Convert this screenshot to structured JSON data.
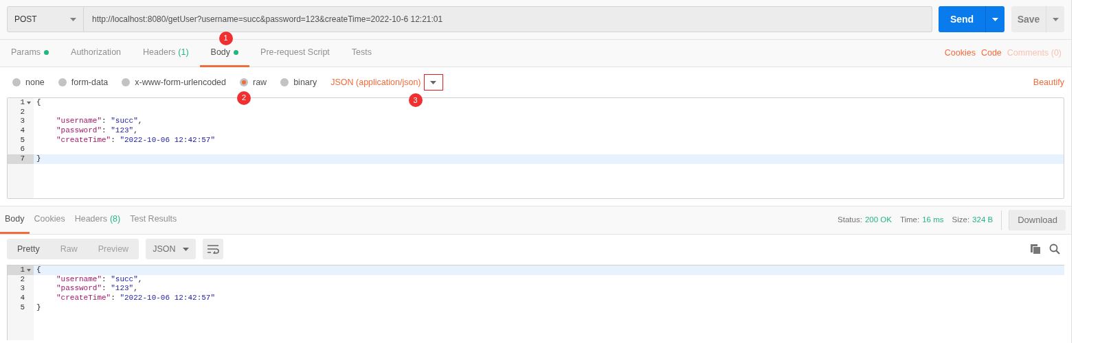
{
  "request": {
    "method": "POST",
    "url": "http://localhost:8080/getUser?username=succ&password=123&createTime=2022-10-6 12:21:01",
    "send": "Send",
    "save": "Save"
  },
  "request_tabs": [
    {
      "label": "Params",
      "dot": true,
      "selected": false
    },
    {
      "label": "Authorization",
      "selected": false
    },
    {
      "label": "Headers",
      "count": "(1)",
      "selected": false
    },
    {
      "label": "Body",
      "dot": true,
      "selected": true,
      "annotation": "1"
    },
    {
      "label": "Pre-request Script",
      "selected": false
    },
    {
      "label": "Tests",
      "selected": false
    }
  ],
  "request_links": [
    {
      "label": "Cookies",
      "disabled": false
    },
    {
      "label": "Code",
      "disabled": false
    },
    {
      "label": "Comments (0)",
      "disabled": true
    }
  ],
  "body_types": [
    {
      "label": "none",
      "selected": false
    },
    {
      "label": "form-data",
      "selected": false
    },
    {
      "label": "x-www-form-urlencoded",
      "selected": false
    },
    {
      "label": "raw",
      "selected": true,
      "annotation": "2"
    },
    {
      "label": "binary",
      "selected": false
    }
  ],
  "body_format": {
    "label": "JSON (application/json)",
    "annotation": "3",
    "boxed": true
  },
  "beautify": "Beautify",
  "request_editor": {
    "lines": [
      {
        "number": "1",
        "fold": true,
        "highlighted": false,
        "tokens": [
          {
            "kind": "punct",
            "text": "{"
          }
        ]
      },
      {
        "number": "2",
        "fold": false,
        "highlighted": false
      },
      {
        "number": "3",
        "fold": false,
        "highlighted": false,
        "indented": true,
        "tokens": [
          {
            "kind": "key",
            "text": "\"username\""
          },
          {
            "kind": "punct",
            "text": ": "
          },
          {
            "kind": "string",
            "text": "\"succ\""
          },
          {
            "kind": "punct",
            "text": ","
          }
        ]
      },
      {
        "number": "4",
        "fold": false,
        "highlighted": false,
        "indented": true,
        "tokens": [
          {
            "kind": "key",
            "text": "\"password\""
          },
          {
            "kind": "punct",
            "text": ": "
          },
          {
            "kind": "string",
            "text": "\"123\""
          },
          {
            "kind": "punct",
            "text": ","
          }
        ]
      },
      {
        "number": "5",
        "fold": false,
        "highlighted": false,
        "indented": true,
        "tokens": [
          {
            "kind": "key",
            "text": "\"createTime\""
          },
          {
            "kind": "punct",
            "text": ": "
          },
          {
            "kind": "string",
            "text": "\"2022-10-06 12:42:57\""
          }
        ]
      },
      {
        "number": "6",
        "fold": false,
        "highlighted": false
      },
      {
        "number": "7",
        "fold": false,
        "highlighted": true,
        "tokens": [
          {
            "kind": "punct",
            "text": "}"
          }
        ]
      }
    ]
  },
  "response_tabs": [
    {
      "label": "Body",
      "selected": true
    },
    {
      "label": "Cookies",
      "selected": false
    },
    {
      "label": "Headers",
      "count": "(8)",
      "selected": false
    },
    {
      "label": "Test Results",
      "selected": false
    }
  ],
  "response_meta": [
    {
      "label": "Status:",
      "value": "200 OK"
    },
    {
      "label": "Time:",
      "value": "16 ms"
    },
    {
      "label": "Size:",
      "value": "324 B"
    }
  ],
  "download": "Download",
  "view_modes": [
    {
      "label": "Pretty",
      "selected": true
    },
    {
      "label": "Raw",
      "selected": false
    },
    {
      "label": "Preview",
      "selected": false
    }
  ],
  "response_format": "JSON",
  "response_editor": {
    "lines": [
      {
        "number": "1",
        "fold": true,
        "highlighted": true,
        "tokens": [
          {
            "kind": "punct",
            "text": "{"
          }
        ]
      },
      {
        "number": "2",
        "fold": false,
        "highlighted": false,
        "indented": true,
        "tokens": [
          {
            "kind": "key",
            "text": "\"username\""
          },
          {
            "kind": "punct",
            "text": ": "
          },
          {
            "kind": "string",
            "text": "\"succ\""
          },
          {
            "kind": "punct",
            "text": ","
          }
        ]
      },
      {
        "number": "3",
        "fold": false,
        "highlighted": false,
        "indented": true,
        "tokens": [
          {
            "kind": "key",
            "text": "\"password\""
          },
          {
            "kind": "punct",
            "text": ": "
          },
          {
            "kind": "string",
            "text": "\"123\""
          },
          {
            "kind": "punct",
            "text": ","
          }
        ]
      },
      {
        "number": "4",
        "fold": false,
        "highlighted": false,
        "indented": true,
        "tokens": [
          {
            "kind": "key",
            "text": "\"createTime\""
          },
          {
            "kind": "punct",
            "text": ": "
          },
          {
            "kind": "string",
            "text": "\"2022-10-06 12:42:57\""
          }
        ]
      },
      {
        "number": "5",
        "fold": false,
        "highlighted": false,
        "tokens": [
          {
            "kind": "punct",
            "text": "}"
          }
        ]
      }
    ]
  }
}
